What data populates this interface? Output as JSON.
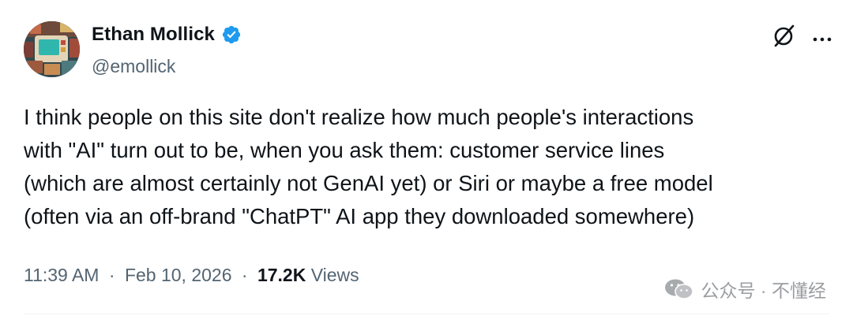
{
  "author": {
    "display_name": "Ethan Mollick",
    "handle": "@emollick"
  },
  "tweet": {
    "lines": [
      "I think people on this site don't realize how much people's interactions",
      "with \"AI\" turn out to be, when you ask them: customer service lines",
      "(which are almost certainly not GenAI yet) or Siri or maybe a free model",
      "(often via an off-brand \"ChatPT\" AI app they downloaded somewhere)"
    ]
  },
  "meta": {
    "time": "11:39 AM",
    "separator": "·",
    "date": "Feb 10, 2026",
    "views_count": "17.2K",
    "views_label": "Views"
  },
  "watermark": {
    "text": "公众号 · 不懂经"
  },
  "icons": {
    "verified": "verified-badge-icon",
    "grok": "grok-icon",
    "more": "more-horizontal-icon",
    "watermark": "wechat-icon"
  },
  "colors": {
    "text_primary": "#0f1419",
    "text_secondary": "#536471",
    "verified_blue": "#1d9bf0"
  }
}
